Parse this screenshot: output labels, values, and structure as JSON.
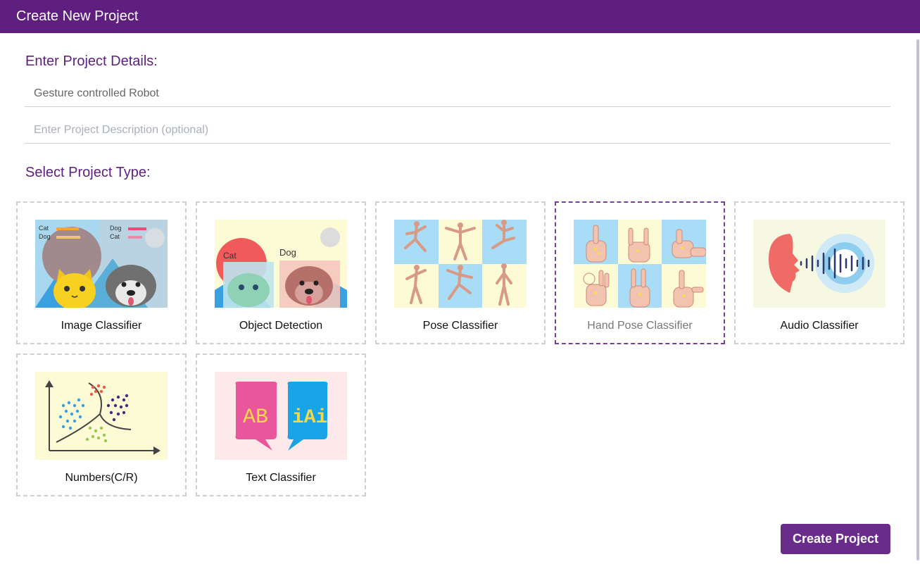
{
  "window": {
    "title": "Create New Project"
  },
  "details": {
    "heading": "Enter Project Details:",
    "name_value": "Gesture controlled Robot",
    "description_placeholder": "Enter Project Description (optional)"
  },
  "type_section": {
    "heading": "Select Project Type:"
  },
  "thumb_text": {
    "cat": "Cat",
    "dog": "Dog",
    "ab": "AB",
    "iai": "iAi"
  },
  "project_types": [
    {
      "label": "Image Classifier",
      "selected": false
    },
    {
      "label": "Object Detection",
      "selected": false
    },
    {
      "label": "Pose Classifier",
      "selected": false
    },
    {
      "label": "Hand Pose Classifier",
      "selected": true
    },
    {
      "label": "Audio Classifier",
      "selected": false
    },
    {
      "label": "Numbers(C/R)",
      "selected": false
    },
    {
      "label": "Text Classifier",
      "selected": false
    }
  ],
  "footer": {
    "create_label": "Create Project"
  },
  "colors": {
    "brand": "#5e1f7f",
    "button": "#6a2c8a",
    "selected_border": "#7a3f96",
    "card_border": "#cfcfcf"
  }
}
